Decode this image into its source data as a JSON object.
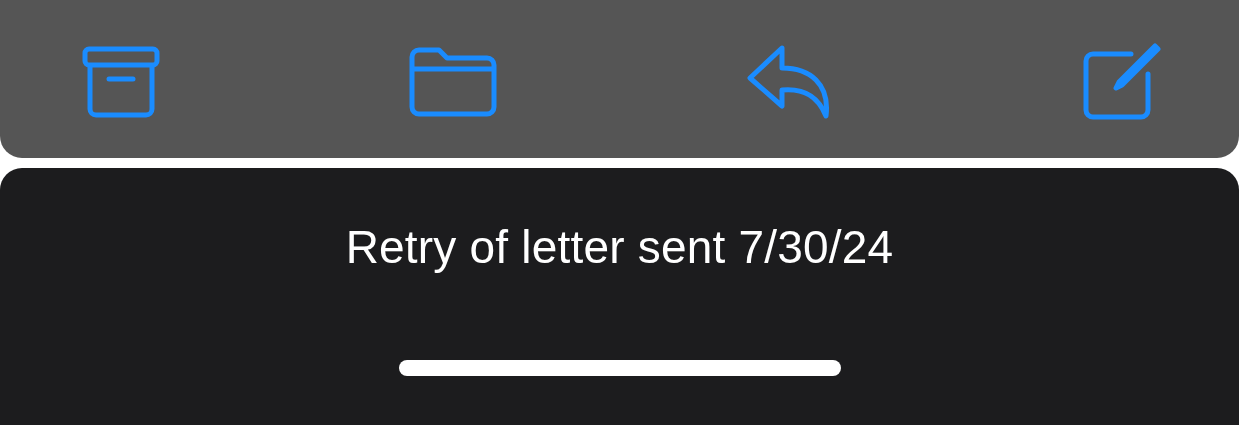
{
  "toolbar": {
    "buttons": [
      {
        "kind": "archive"
      },
      {
        "kind": "folder"
      },
      {
        "kind": "reply"
      },
      {
        "kind": "compose"
      }
    ]
  },
  "sheet": {
    "title": "Retry of letter sent 7/30/24"
  }
}
